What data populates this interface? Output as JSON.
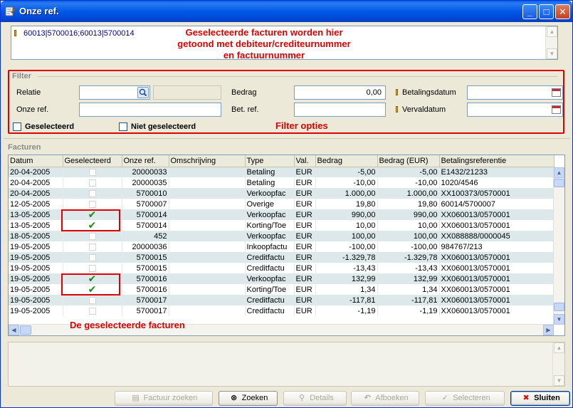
{
  "window": {
    "title": "Onze ref."
  },
  "selection": {
    "value": "60013|5700016;60013|5700014",
    "annotation_line1": "Geselecteerde facturen worden hier",
    "annotation_line2": "getoond met debiteur/crediteurnummer",
    "annotation_line3": "en factuurnummer"
  },
  "filter": {
    "title": "Filter",
    "relatie_label": "Relatie",
    "onze_ref_label": "Onze ref.",
    "bedrag_label": "Bedrag",
    "bedrag_value": "0,00",
    "bet_ref_label": "Bet. ref.",
    "betalingsdatum_label": "Betalingsdatum",
    "vervaldatum_label": "Vervaldatum",
    "geselecteerd_label": "Geselecteerd",
    "niet_geselecteerd_label": "Niet geselecteerd",
    "annotation": "Filter opties"
  },
  "facturen": {
    "title": "Facturen",
    "columns": [
      "Datum",
      "Geselecteerd",
      "Onze ref.",
      "Omschrijving",
      "Type",
      "Val.",
      "Bedrag",
      "Bedrag (EUR)",
      "Betalingsreferentie"
    ],
    "rows": [
      {
        "datum": "20-04-2005",
        "selected": false,
        "ref": "20000033",
        "omschrijving": "",
        "type": "Betaling",
        "val": "EUR",
        "bedrag": "-5,00",
        "bedrag_eur": "-5,00",
        "betref": "E1432/21233"
      },
      {
        "datum": "20-04-2005",
        "selected": false,
        "ref": "20000035",
        "omschrijving": "",
        "type": "Betaling",
        "val": "EUR",
        "bedrag": "-10,00",
        "bedrag_eur": "-10,00",
        "betref": "1020/4546"
      },
      {
        "datum": "20-04-2005",
        "selected": false,
        "ref": "5700010",
        "omschrijving": "",
        "type": "Verkoopfac",
        "val": "EUR",
        "bedrag": "1.000,00",
        "bedrag_eur": "1.000,00",
        "betref": "XX100373/0570001"
      },
      {
        "datum": "12-05-2005",
        "selected": false,
        "ref": "5700007",
        "omschrijving": "",
        "type": "Overige",
        "val": "EUR",
        "bedrag": "19,80",
        "bedrag_eur": "19,80",
        "betref": "60014/5700007"
      },
      {
        "datum": "13-05-2005",
        "selected": true,
        "ref": "5700014",
        "omschrijving": "",
        "type": "Verkoopfac",
        "val": "EUR",
        "bedrag": "990,00",
        "bedrag_eur": "990,00",
        "betref": "XX060013/0570001"
      },
      {
        "datum": "13-05-2005",
        "selected": true,
        "ref": "5700014",
        "omschrijving": "",
        "type": "Korting/Toe",
        "val": "EUR",
        "bedrag": "10,00",
        "bedrag_eur": "10,00",
        "betref": "XX060013/0570001"
      },
      {
        "datum": "18-05-2005",
        "selected": false,
        "ref": "452",
        "omschrijving": "",
        "type": "Verkoopfac",
        "val": "EUR",
        "bedrag": "100,00",
        "bedrag_eur": "100,00",
        "betref": "XX088888/0000045"
      },
      {
        "datum": "19-05-2005",
        "selected": false,
        "ref": "20000036",
        "omschrijving": "",
        "type": "Inkoopfactu",
        "val": "EUR",
        "bedrag": "-100,00",
        "bedrag_eur": "-100,00",
        "betref": "984767/213"
      },
      {
        "datum": "19-05-2005",
        "selected": false,
        "ref": "5700015",
        "omschrijving": "",
        "type": "Creditfactu",
        "val": "EUR",
        "bedrag": "-1.329,78",
        "bedrag_eur": "-1.329,78",
        "betref": "XX060013/0570001"
      },
      {
        "datum": "19-05-2005",
        "selected": false,
        "ref": "5700015",
        "omschrijving": "",
        "type": "Creditfactu",
        "val": "EUR",
        "bedrag": "-13,43",
        "bedrag_eur": "-13,43",
        "betref": "XX060013/0570001"
      },
      {
        "datum": "19-05-2005",
        "selected": true,
        "ref": "5700016",
        "omschrijving": "",
        "type": "Verkoopfac",
        "val": "EUR",
        "bedrag": "132,99",
        "bedrag_eur": "132,99",
        "betref": "XX060013/0570001"
      },
      {
        "datum": "19-05-2005",
        "selected": true,
        "ref": "5700016",
        "omschrijving": "",
        "type": "Korting/Toe",
        "val": "EUR",
        "bedrag": "1,34",
        "bedrag_eur": "1,34",
        "betref": "XX060013/0570001"
      },
      {
        "datum": "19-05-2005",
        "selected": false,
        "ref": "5700017",
        "omschrijving": "",
        "type": "Creditfactu",
        "val": "EUR",
        "bedrag": "-117,81",
        "bedrag_eur": "-117,81",
        "betref": "XX060013/0570001"
      },
      {
        "datum": "19-05-2005",
        "selected": false,
        "ref": "5700017",
        "omschrijving": "",
        "type": "Creditfactu",
        "val": "EUR",
        "bedrag": "-1,19",
        "bedrag_eur": "-1,19",
        "betref": "XX060013/0570001"
      }
    ],
    "annotation": "De geselecteerde facturen"
  },
  "buttons": {
    "factuur_zoeken": "Factuur zoeken",
    "zoeken": "Zoeken",
    "details": "Details",
    "afboeken": "Afboeken",
    "selecteren": "Selecteren",
    "sluiten": "Sluiten"
  },
  "colors": {
    "annotation": "#E00000",
    "check": "#1E8A1E",
    "row_alt": "#DCE8EA",
    "titlebar": "#0058E6"
  }
}
